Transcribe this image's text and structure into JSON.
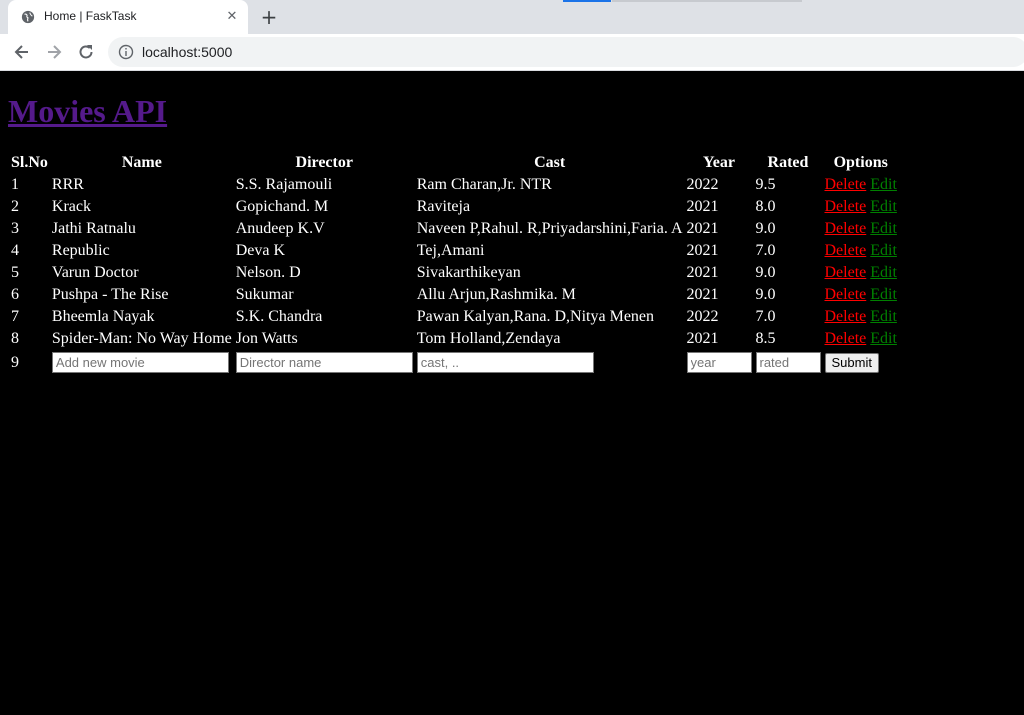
{
  "browser": {
    "tab_title": "Home | FaskTask",
    "close_glyph": "✕",
    "new_tab_glyph": "+",
    "url": "localhost:5000"
  },
  "page": {
    "heading": "Movies API"
  },
  "table": {
    "headers": [
      "Sl.No",
      "Name",
      "Director",
      "Cast",
      "Year",
      "Rated",
      "Options"
    ],
    "rows": [
      {
        "sl": "1",
        "name": "RRR",
        "director": "S.S. Rajamouli",
        "cast": "Ram Charan,Jr. NTR",
        "year": "2022",
        "rated": "9.5"
      },
      {
        "sl": "2",
        "name": "Krack",
        "director": "Gopichand. M",
        "cast": "Raviteja",
        "year": "2021",
        "rated": "8.0"
      },
      {
        "sl": "3",
        "name": "Jathi Ratnalu",
        "director": "Anudeep K.V",
        "cast": "Naveen P,Rahul. R,Priyadarshini,Faria. A",
        "year": "2021",
        "rated": "9.0"
      },
      {
        "sl": "4",
        "name": "Republic",
        "director": "Deva K",
        "cast": "Tej,Amani",
        "year": "2021",
        "rated": "7.0"
      },
      {
        "sl": "5",
        "name": "Varun Doctor",
        "director": "Nelson. D",
        "cast": "Sivakarthikeyan",
        "year": "2021",
        "rated": "9.0"
      },
      {
        "sl": "6",
        "name": "Pushpa - The Rise",
        "director": "Sukumar",
        "cast": "Allu Arjun,Rashmika. M",
        "year": "2021",
        "rated": "9.0"
      },
      {
        "sl": "7",
        "name": "Bheemla Nayak",
        "director": "S.K. Chandra",
        "cast": "Pawan Kalyan,Rana. D,Nitya Menen",
        "year": "2022",
        "rated": "7.0"
      },
      {
        "sl": "8",
        "name": "Spider-Man: No Way Home",
        "director": "Jon Watts",
        "cast": "Tom Holland,Zendaya",
        "year": "2021",
        "rated": "8.5"
      }
    ],
    "delete_label": "Delete",
    "edit_label": "Edit",
    "new_row": {
      "sl": "9",
      "name_placeholder": "Add new movie",
      "director_placeholder": "Director name",
      "cast_placeholder": "cast, ..",
      "year_placeholder": "year",
      "rated_placeholder": "rated",
      "submit_label": "Submit"
    }
  },
  "colors": {
    "page_bg": "#000000",
    "heading_link": "#551a8b",
    "delete_link": "#ff0000",
    "edit_link": "#008000"
  }
}
